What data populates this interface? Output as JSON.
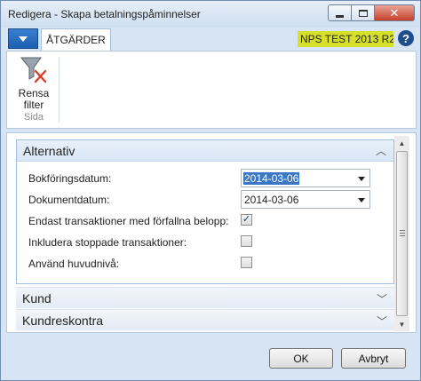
{
  "window": {
    "title": "Redigera - Skapa betalningspåminnelser"
  },
  "ribbon": {
    "tab_label": "ÅTGÄRDER",
    "company": "NPS TEST 2013 R2...",
    "help_label": "?",
    "buttons": [
      {
        "label_line1": "Rensa",
        "label_line2": "filter",
        "icon": "clear-filter-icon"
      }
    ],
    "group_label": "Sida"
  },
  "fasttabs": {
    "alternativ": {
      "title": "Alternativ",
      "fields": {
        "bokforingsdatum": {
          "label": "Bokföringsdatum:",
          "value": "2014-03-06"
        },
        "dokumentdatum": {
          "label": "Dokumentdatum:",
          "value": "2014-03-06"
        },
        "endast_forfallna": {
          "label": "Endast transaktioner med förfallna belopp:",
          "checked": true,
          "mark": "✓"
        },
        "inkludera_stoppade": {
          "label": "Inkludera stoppade transaktioner:",
          "checked": false
        },
        "anvand_huvudniva": {
          "label": "Använd huvudnivå:",
          "checked": false
        }
      }
    },
    "kund": {
      "title": "Kund"
    },
    "kundreskontra": {
      "title": "Kundreskontra"
    }
  },
  "buttons": {
    "ok": "OK",
    "cancel": "Avbryt"
  },
  "colors": {
    "accent": "#1d5fb0",
    "company_badge": "#d6e02a",
    "selection": "#3a76c4"
  }
}
